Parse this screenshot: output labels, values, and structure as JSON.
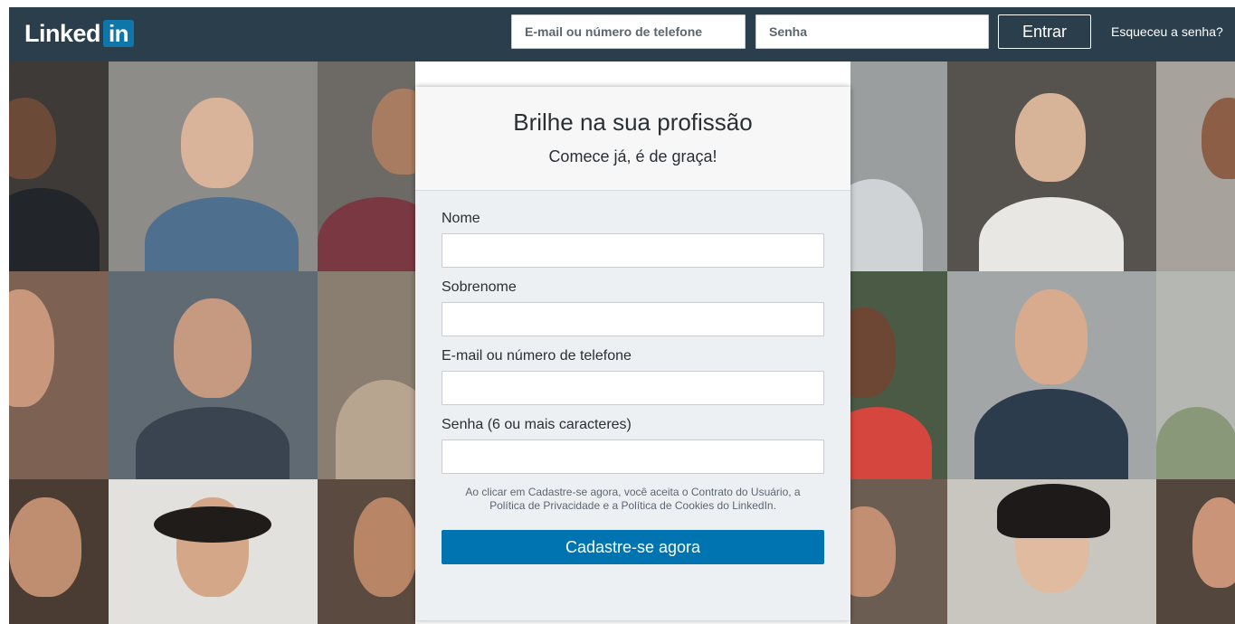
{
  "header": {
    "logo_word": "Linked",
    "logo_box": "in",
    "email_placeholder": "E-mail ou número de telefone",
    "password_placeholder": "Senha",
    "login_label": "Entrar",
    "forgot_label": "Esqueceu a senha?"
  },
  "card": {
    "title": "Brilhe na sua profissão",
    "subtitle": "Comece já, é de graça!",
    "fields": [
      {
        "label": "Nome"
      },
      {
        "label": "Sobrenome"
      },
      {
        "label": "E-mail ou número de telefone"
      },
      {
        "label": "Senha (6 ou mais caracteres)"
      }
    ],
    "terms": "Ao clicar em Cadastre-se agora, você aceita o Contrato do Usuário, a Política de Privacidade e a Política de Cookies do LinkedIn.",
    "signup_label": "Cadastre-se agora"
  },
  "colors": {
    "header_bg": "#2b3e4c",
    "brand_blue": "#0e76a8",
    "button_blue": "#0073b1",
    "card_body_bg": "#edf0f3"
  }
}
